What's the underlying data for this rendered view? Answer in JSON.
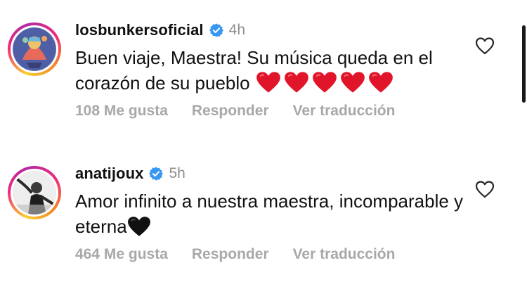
{
  "comments": [
    {
      "username": "losbunkersoficial",
      "time": "4h",
      "text": "Buen viaje, Maestra! Su música queda en el corazón de su pueblo",
      "emoji": "heart-red-x5",
      "likes": "108 Me gusta",
      "reply": "Responder",
      "translate": "Ver traducción"
    },
    {
      "username": "anatijoux",
      "time": "5h",
      "text": "Amor infinito a nuestra maestra, incomparable y eterna",
      "emoji": "heart-black",
      "likes": "464 Me gusta",
      "reply": "Responder",
      "translate": "Ver traducción"
    }
  ],
  "icons": {
    "verified": "verified-badge-icon",
    "like": "heart-outline-icon"
  },
  "colors": {
    "verified": "#3897f0",
    "heart": "#e0152a",
    "secondary_text": "#8e8e8e",
    "action_text": "#a8a8a8"
  }
}
